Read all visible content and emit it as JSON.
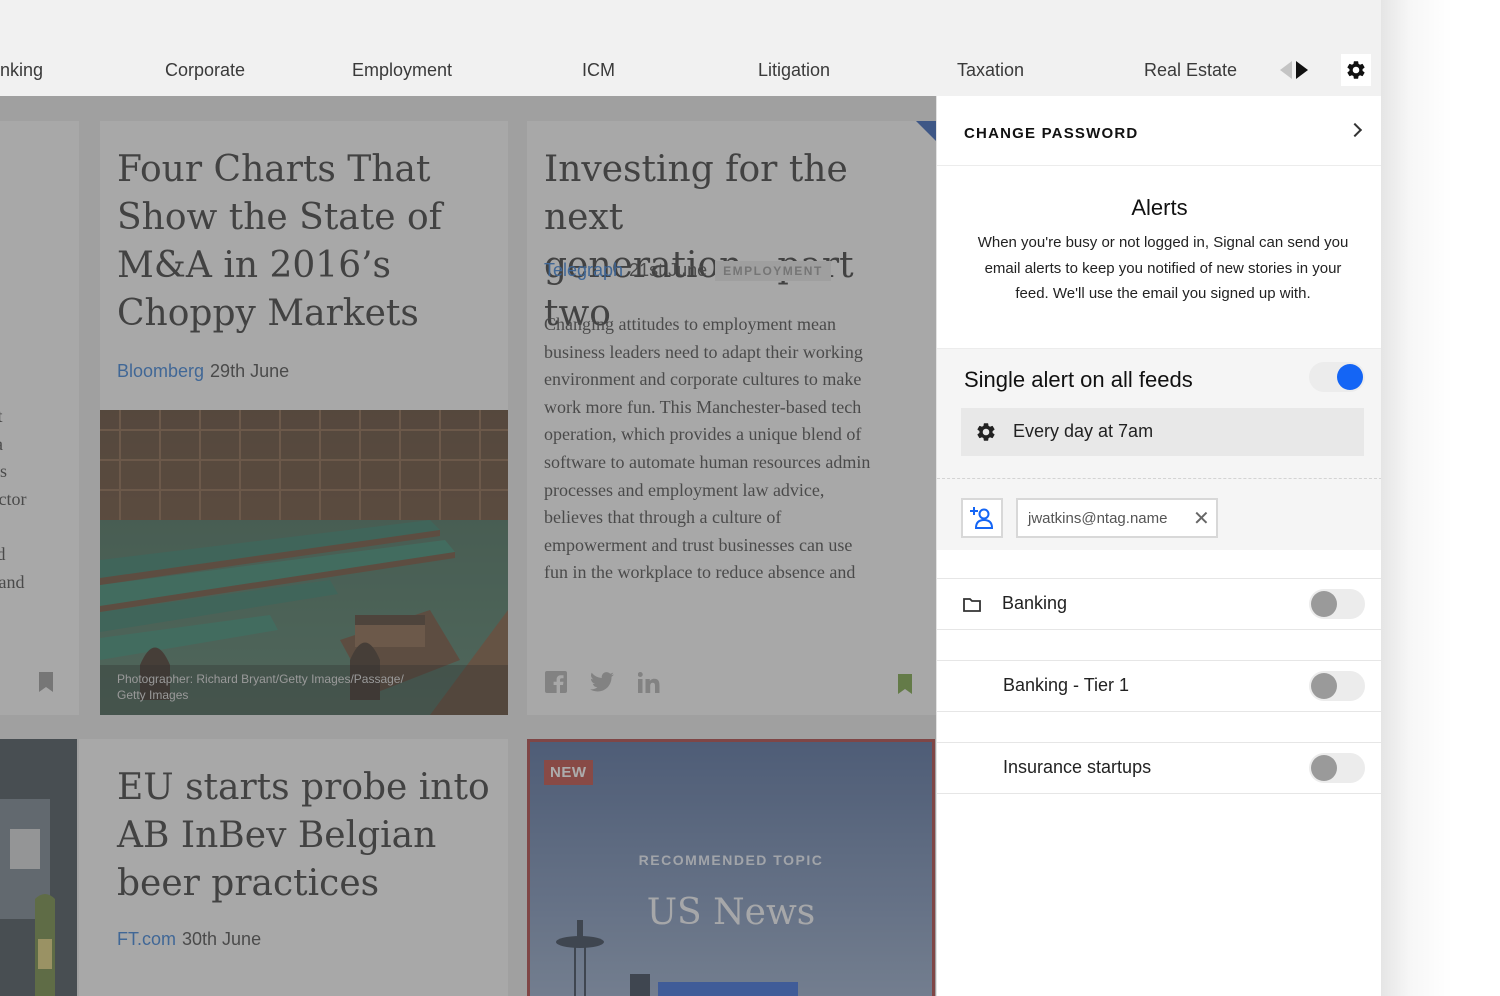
{
  "nav": {
    "items": [
      "nking",
      "Corporate",
      "Employment",
      "ICM",
      "Litigation",
      "Taxation",
      "Real Estate"
    ]
  },
  "cards": {
    "partial_lines": [
      "t not",
      "ks, a",
      "eenis",
      "g sector",
      "",
      "l and",
      "gs” and"
    ],
    "ma": {
      "title_lines": [
        "Four Charts That",
        "Show the State of",
        "M&A in 2016’s",
        "Choppy Markets"
      ],
      "source": "Bloomberg",
      "date": "29th June",
      "photo_credit_1": "Photographer: Richard Bryant/Getty Images/Passage/",
      "photo_credit_2": "Getty Images"
    },
    "investing": {
      "title_lines": [
        "Investing for the next",
        "generation - part two"
      ],
      "source": "Telegraph",
      "date": "21st June",
      "tag": "EMPLOYMENT",
      "body_lines": [
        "Changing attitudes to employment mean",
        "business leaders need to adapt their working",
        "environment and corporate cultures to make",
        "work more fun. This Manchester-based tech",
        "operation, which provides a unique blend of",
        "software to automate human resources admin",
        "processes and employment law advice,",
        "believes that through a culture of",
        "empowerment and trust businesses can use",
        "fun in the workplace to reduce absence and"
      ]
    },
    "eu": {
      "title_lines": [
        "EU starts probe into",
        "AB InBev Belgian",
        "beer practices"
      ],
      "source": "FT.com",
      "date": "30th June"
    },
    "recommended": {
      "badge": "NEW",
      "kicker": "RECOMMENDED TOPIC",
      "title": "US News"
    }
  },
  "panel": {
    "change_password": "CHANGE PASSWORD",
    "alerts_title": "Alerts",
    "alerts_desc_lines": [
      "When you're busy or not logged in, Signal can send you",
      "email alerts to keep you notified of new stories in your",
      "feed. We'll use the email you signed up with."
    ],
    "single_alert_label": "Single alert on all feeds",
    "single_alert_on": true,
    "schedule": "Every day at 7am",
    "email": "jwatkins@ntag.name",
    "feeds": [
      {
        "label": "Banking",
        "on": false
      },
      {
        "label": "Banking - Tier 1",
        "on": false
      },
      {
        "label": "Insurance startups",
        "on": false
      }
    ]
  },
  "colors": {
    "accent_blue": "#1465f5",
    "link_blue": "#1f6fd1",
    "new_badge": "#c0392b",
    "bookmark_green": "#6a9a2e"
  }
}
